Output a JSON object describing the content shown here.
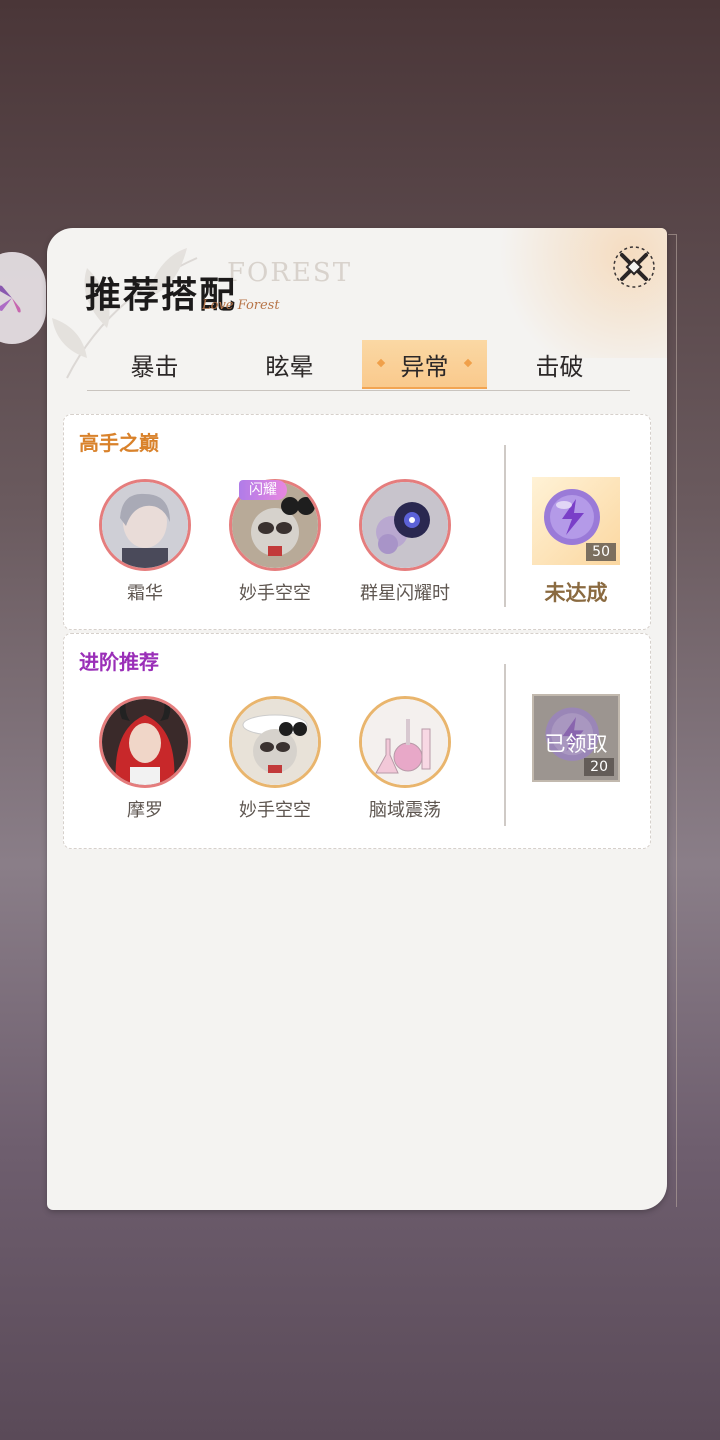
{
  "panel": {
    "title": "推荐搭配",
    "subtitle": "Love Forest",
    "faint_word": "FOREST"
  },
  "tabs": [
    {
      "label": "暴击",
      "active": false
    },
    {
      "label": "眩晕",
      "active": false
    },
    {
      "label": "异常",
      "active": true
    },
    {
      "label": "击破",
      "active": false
    }
  ],
  "sections": [
    {
      "title": "高手之巅",
      "title_color": "#d9822b",
      "items": [
        {
          "label": "霜华",
          "ring": "red"
        },
        {
          "label": "妙手空空",
          "ring": "red",
          "badge": "闪耀"
        },
        {
          "label": "群星闪耀时",
          "ring": "red"
        }
      ],
      "reward": {
        "count": "50",
        "status": "未达成",
        "claimed": false
      }
    },
    {
      "title": "进阶推荐",
      "title_color": "#9a2fb8",
      "items": [
        {
          "label": "摩罗",
          "ring": "red"
        },
        {
          "label": "妙手空空",
          "ring": "gold"
        },
        {
          "label": "脑域震荡",
          "ring": "gold"
        }
      ],
      "reward": {
        "count": "20",
        "status": "已领取",
        "claimed": true
      }
    }
  ],
  "colors": {
    "accent_tab": "#f9c98c",
    "red_ring": "#e57d7d",
    "gold_ring": "#e9b56d"
  }
}
